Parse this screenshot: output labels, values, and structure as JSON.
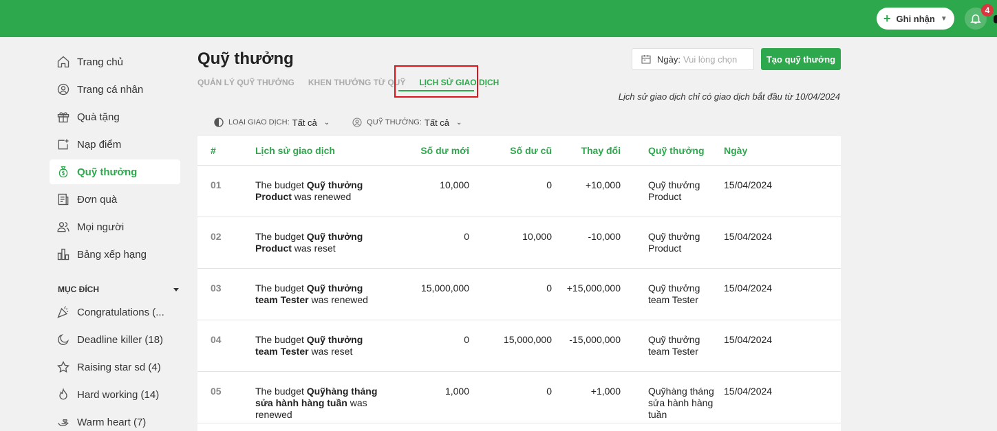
{
  "topbar": {
    "ghi_nhan_label": "Ghi nhận",
    "notification_count": "4",
    "color": "#2ea84d"
  },
  "sidebar": {
    "items": [
      {
        "label": "Trang chủ",
        "icon": "home-icon"
      },
      {
        "label": "Trang cá nhân",
        "icon": "user-circle-icon"
      },
      {
        "label": "Quà tặng",
        "icon": "gift-icon"
      },
      {
        "label": "Nạp điểm",
        "icon": "add-card-icon"
      },
      {
        "label": "Quỹ thưởng",
        "icon": "money-bag-icon",
        "active": true
      },
      {
        "label": "Đơn quà",
        "icon": "receipt-icon"
      },
      {
        "label": "Mọi người",
        "icon": "users-icon"
      },
      {
        "label": "Bảng xếp hạng",
        "icon": "leaderboard-icon"
      }
    ],
    "section_title": "MỤC ĐÍCH",
    "purposes": [
      {
        "label": "Congratulations (...",
        "icon": "party-icon"
      },
      {
        "label": "Deadline killer (18)",
        "icon": "moon-icon"
      },
      {
        "label": "Raising star sd (4)",
        "icon": "star-icon"
      },
      {
        "label": "Hard working (14)",
        "icon": "fire-icon"
      },
      {
        "label": "Warm heart (7)",
        "icon": "heart-hand-icon"
      }
    ]
  },
  "header": {
    "title": "Quỹ thưởng",
    "tabs": [
      {
        "label": "QUẢN LÝ QUỸ THƯỞNG"
      },
      {
        "label": "KHEN THƯỞNG TỪ QUỸ"
      },
      {
        "label": "LỊCH SỬ GIAO DỊCH",
        "active": true
      }
    ],
    "date_label": "Ngày:",
    "date_placeholder": "Vui lòng chọn",
    "create_label": "Tạo quỹ thưởng",
    "note": "Lịch sử giao dịch chỉ có giao dịch bắt đầu từ 10/04/2024"
  },
  "filters": [
    {
      "label": "LOẠI GIAO DỊCH:",
      "value": "Tất cả",
      "icon": "half-circle-icon"
    },
    {
      "label": "QUỸ THƯỞNG:",
      "value": "Tất cả",
      "icon": "person-circle-icon"
    }
  ],
  "table": {
    "columns": [
      "#",
      "Lịch sử giao dịch",
      "Số dư mới",
      "Số dư cũ",
      "Thay đổi",
      "Quỹ thưởng",
      "Ngày"
    ],
    "rows": [
      {
        "idx": "01",
        "pre": "The budget ",
        "bold": "Quỹ thưởng Product",
        "post": " was renewed",
        "new": "10,000",
        "old": "0",
        "change": "+10,000",
        "fund": "Quỹ thưởng Product",
        "date": "15/04/2024"
      },
      {
        "idx": "02",
        "pre": "The budget ",
        "bold": "Quỹ thưởng Product",
        "post": " was reset",
        "new": "0",
        "old": "10,000",
        "change": "-10,000",
        "fund": "Quỹ thưởng Product",
        "date": "15/04/2024"
      },
      {
        "idx": "03",
        "pre": "The budget ",
        "bold": "Quỹ thưởng team Tester",
        "post": " was renewed",
        "new": "15,000,000",
        "old": "0",
        "change": "+15,000,000",
        "fund": "Quỹ thưởng team Tester",
        "date": "15/04/2024"
      },
      {
        "idx": "04",
        "pre": "The budget ",
        "bold": "Quỹ thưởng team Tester",
        "post": " was reset",
        "new": "0",
        "old": "15,000,000",
        "change": "-15,000,000",
        "fund": "Quỹ thưởng team Tester",
        "date": "15/04/2024"
      },
      {
        "idx": "05",
        "pre": "The budget ",
        "bold": "Quỹhàng tháng sửa hành hàng tuần",
        "post": " was renewed",
        "new": "1,000",
        "old": "0",
        "change": "+1,000",
        "fund": "Quỹhàng tháng sửa hành hàng tuần",
        "date": "15/04/2024"
      }
    ]
  }
}
